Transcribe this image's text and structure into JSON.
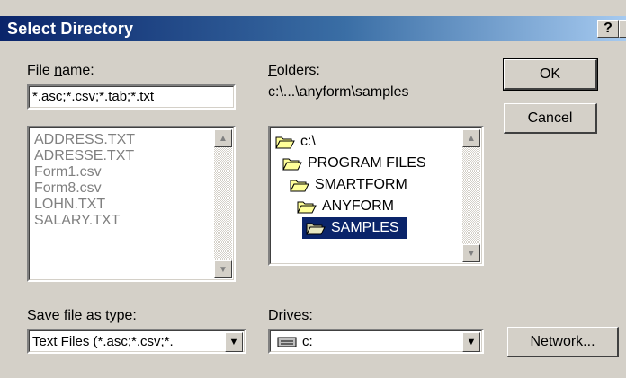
{
  "dialog": {
    "title": "Select Directory",
    "help_button": "?",
    "close_button": "×"
  },
  "file_name": {
    "label_prefix": "File ",
    "label_key": "n",
    "label_suffix": "ame:",
    "value": "*.asc;*.csv;*.tab;*.txt",
    "files": [
      "ADDRESS.TXT",
      "ADRESSE.TXT",
      "Form1.csv",
      "Form8.csv",
      "LOHN.TXT",
      "SALARY.TXT"
    ]
  },
  "folders": {
    "label_key": "F",
    "label_suffix": "olders:",
    "current_path": "c:\\...\\anyform\\samples",
    "tree": [
      {
        "label": "c:\\",
        "icon": "open-folder-icon"
      },
      {
        "label": "PROGRAM FILES",
        "icon": "open-folder-icon"
      },
      {
        "label": "SMARTFORM",
        "icon": "open-folder-icon"
      },
      {
        "label": "ANYFORM",
        "icon": "open-folder-icon"
      },
      {
        "label": "SAMPLES",
        "icon": "open-folder-icon",
        "selected": true
      }
    ]
  },
  "save_type": {
    "label_prefix": "Save file as ",
    "label_key": "t",
    "label_suffix": "ype:",
    "value": "Text Files (*.asc;*.csv;*."
  },
  "drives": {
    "label_prefix": "Dri",
    "label_key": "v",
    "label_suffix": "es:",
    "value": "c:",
    "icon": "drive-icon"
  },
  "buttons": {
    "ok": "OK",
    "cancel": "Cancel",
    "network_prefix": "Net",
    "network_key": "w",
    "network_suffix": "ork..."
  },
  "colors": {
    "face": "#d4d0c8",
    "titlebar_start": "#0a246a",
    "titlebar_end": "#a6caf0",
    "selection": "#0a246a",
    "disabled_text": "#808080",
    "folder_yellow": "#ffff99"
  }
}
